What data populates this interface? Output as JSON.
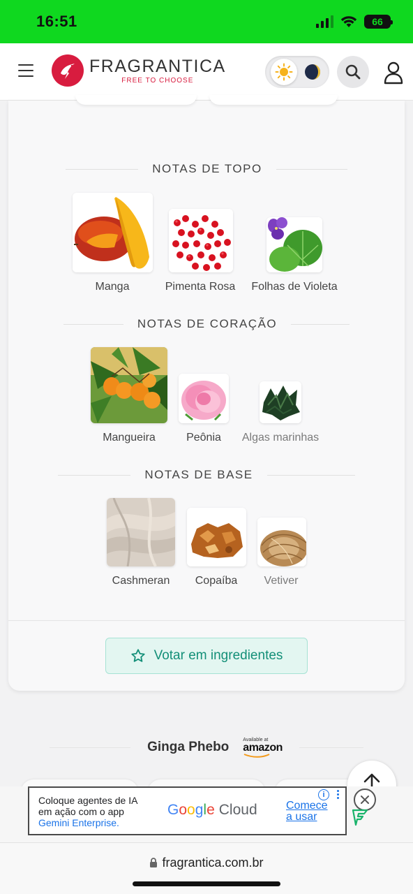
{
  "status_bar": {
    "time": "16:51",
    "battery": "66"
  },
  "header": {
    "logo_name": "FRAGRANTICA",
    "logo_tagline": "FREE TO CHOOSE",
    "brand_color": "#d81c3f"
  },
  "notes": {
    "top": {
      "title": "NOTAS DE TOPO",
      "items": [
        {
          "name": "Manga"
        },
        {
          "name": "Pimenta Rosa"
        },
        {
          "name": "Folhas de Violeta"
        }
      ]
    },
    "heart": {
      "title": "NOTAS DE CORAÇÃO",
      "items": [
        {
          "name": "Mangueira"
        },
        {
          "name": "Peônia"
        },
        {
          "name": "Algas marinhas"
        }
      ]
    },
    "base": {
      "title": "NOTAS DE BASE",
      "items": [
        {
          "name": "Cashmeran"
        },
        {
          "name": "Copaíba"
        },
        {
          "name": "Vetiver"
        }
      ]
    }
  },
  "vote_button": {
    "label": "Votar em ingredientes",
    "color": "#138f78"
  },
  "ginga": {
    "title": "Ginga Phebo",
    "amazon_avail": "Available at",
    "amazon_word": "amazon"
  },
  "ad": {
    "line1": "Coloque agentes de IA",
    "line2": "em ação com o app",
    "line3": "Gemini Enterprise.",
    "logo_google": "Google",
    "logo_cloud": "Cloud",
    "cta_line1": "Comece",
    "cta_line2": "a usar"
  },
  "browser": {
    "url": "fragrantica.com.br"
  }
}
